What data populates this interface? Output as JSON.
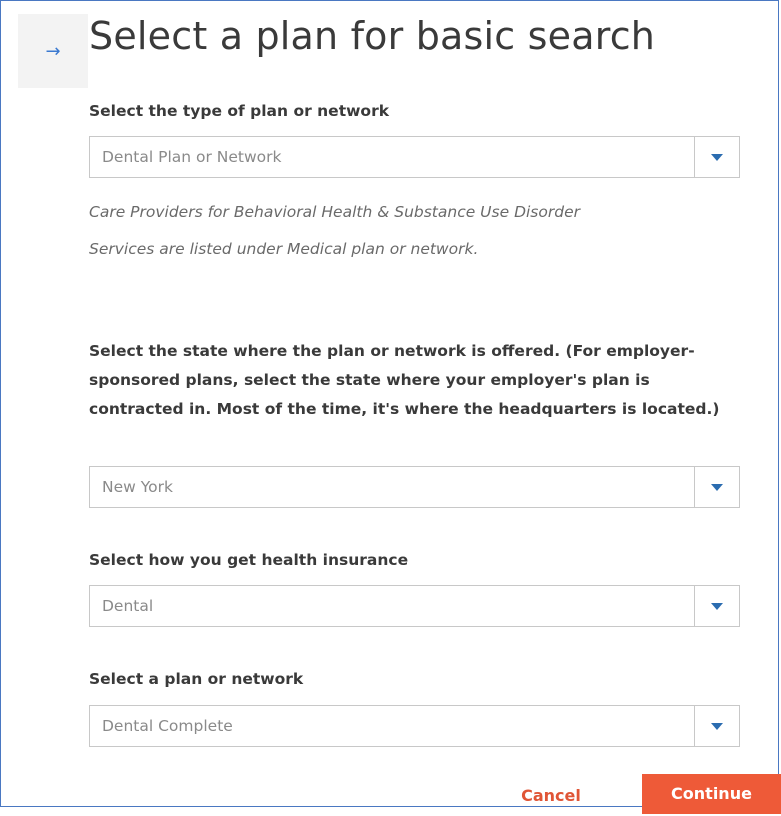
{
  "header": {
    "back_icon": "arrow-right-icon",
    "back_glyph": "→",
    "title": "Select a plan for basic search"
  },
  "plan_type": {
    "label": "Select the type of plan or network",
    "value": "Dental Plan or Network",
    "note": "Care Providers for Behavioral Health & Substance Use Disorder Services are listed under Medical plan or network."
  },
  "state": {
    "label": "Select the state where the plan or network is offered. (For employer-sponsored plans, select the state where your employer's plan is contracted in. Most of the time, it's where the headquarters is located.)",
    "value": "New York"
  },
  "insurance_source": {
    "label": "Select how you get health insurance",
    "value": "Dental"
  },
  "plan": {
    "label": "Select a plan or network",
    "value": "Dental Complete"
  },
  "footer": {
    "cancel_label": "Cancel",
    "continue_label": "Continue"
  },
  "colors": {
    "accent": "#ee5a38",
    "caret": "#2b6cb0",
    "border": "#4a78c2"
  }
}
